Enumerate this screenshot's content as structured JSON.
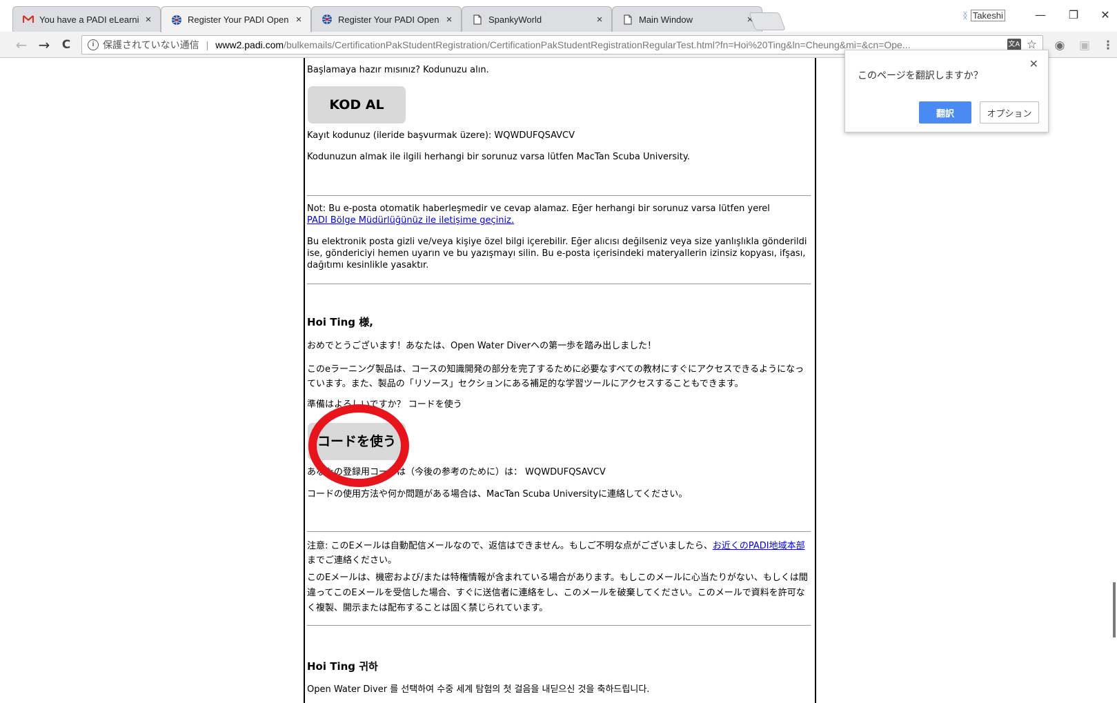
{
  "tabs": [
    {
      "title": "You have a PADI eLearnin",
      "icon": "gmail-icon",
      "active": false
    },
    {
      "title": "Register Your PADI Open",
      "icon": "padi-globe-icon",
      "active": true
    },
    {
      "title": "Register Your PADI Open",
      "icon": "padi-globe-icon",
      "active": false
    },
    {
      "title": "SpankyWorld",
      "icon": "document-icon",
      "active": false
    },
    {
      "title": "Main Window",
      "icon": "document-icon",
      "active": false
    }
  ],
  "tab_close": "×",
  "profile": {
    "name": "Takeshi"
  },
  "window_controls": {
    "minimize": "—",
    "restore": "❐",
    "close": "✕"
  },
  "toolbar": {
    "back": "←",
    "forward": "→",
    "reload": "C",
    "info": "i",
    "security_label": "保護されていない通信",
    "separator": "|",
    "url_host": "www2.padi.com",
    "url_path": "/bulkemails/CertificationPakStudentRegistration/CertificationPakStudentRegistrationRegularTest.html?fn=Hoi%20Ting&ln=Cheung&mi=&cn=Ope...",
    "translate_icon": "文A",
    "star": "☆",
    "camera": "◉",
    "ext": "▣",
    "menu": "⋮"
  },
  "translate_popup": {
    "question": "このページを翻訳しますか？",
    "translate_button": "翻訳",
    "options_button": "オプション",
    "close": "✕"
  },
  "email": {
    "tr": {
      "ready": "Başlamaya hazır mısınız?  Kodunuzu alın.",
      "button": "KOD AL",
      "code_line": "Kayıt kodunuz (ileride başvurmak üzere): WQWDUFQSAVCV",
      "help_line": "Kodunuzun almak ile ilgili herhangi bir sorunuz varsa lütfen MacTan Scuba University.",
      "note_text": "Not: Bu e-posta otomatik haberleşmedir ve cevap alamaz.  Eğer herhangi bir sorunuz varsa lütfen yerel",
      "note_link": "PADI Bölge Müdürlüğünüz ile iletişime geçiniz.",
      "confidential": "Bu elektronik posta gizli ve/veya kişiye özel bilgi içerebilir.  Eğer alıcısı değilseniz veya size yanlışlıkla gönderildi ise, göndericiyi hemen uyarın ve bu yazışmayı silin.  Bu e-posta içerisindeki materyallerin izinsiz kopyası, ifşası, dağıtımı kesinlikle yasaktır."
    },
    "ja": {
      "greeting": "Hoi Ting 様,",
      "congrats": "おめでとうございます！あなたは、Open Water Diverへの第一歩を踏み出しました！",
      "product": "このeラーニング製品は、コースの知識開発の部分を完了するために必要なすべての教材にすぐにアクセスできるようになっています。また、製品の「リソース」セクションにある補足的な学習ツールにアクセスすることもできます。",
      "ready": "準備はよろしいですか？  コードを使う",
      "button": "コードを使う",
      "code_line": "あなたの登録用コードは（今後の参考のために）は： WQWDUFQSAVCV",
      "help_line": "コードの使用方法や何か問題がある場合は、MacTan Scuba Universityに連絡してください。",
      "note_text": "注意: このEメールは自動配信メールなので、返信はできません。もしご不明な点がございましたら、",
      "note_link": "お近くのPADI地域本部",
      "note_after": "までご連絡ください。",
      "confidential": "このEメールは、機密および/または特権情報が含まれている場合があります。もしこのメールに心当たりがない、もしくは間違ってこのEメールを受信した場合、すぐに送信者に連絡をし、このメールを破棄してください。このメールで資料を許可なく複製、開示または配布することは固く禁じられています。"
    },
    "ko": {
      "greeting": "Hoi Ting 귀하",
      "line1": "Open Water Diver 를 선택하여 수중 세계 탐험의 첫 걸음을 내딛으신 것을 축하드립니다."
    }
  },
  "colors": {
    "highlight_circle": "#e8141b",
    "link": "#0000ee",
    "translate_button": "#4a8af4"
  }
}
